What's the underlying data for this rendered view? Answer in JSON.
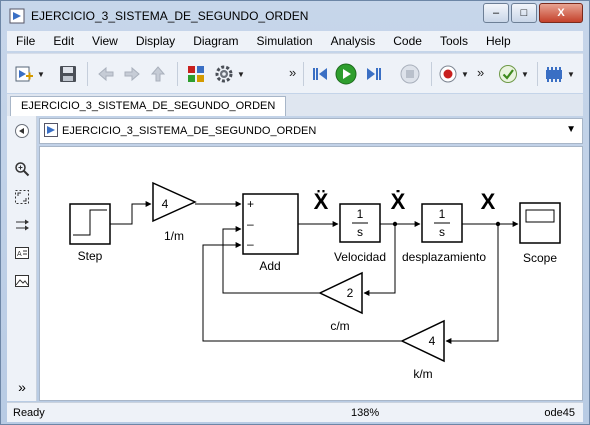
{
  "window": {
    "title": "EJERCICIO_3_SISTEMA_DE_SEGUNDO_ORDEN",
    "minimize": "–",
    "maximize": "□",
    "close": "X"
  },
  "menu": [
    "File",
    "Edit",
    "View",
    "Display",
    "Diagram",
    "Simulation",
    "Analysis",
    "Code",
    "Tools",
    "Help"
  ],
  "toolbar": {
    "overflow1": "»",
    "overflow2": "»"
  },
  "tab": {
    "label": "EJERCICIO_3_SISTEMA_DE_SEGUNDO_ORDEN"
  },
  "address": {
    "path": "EJERCICIO_3_SISTEMA_DE_SEGUNDO_ORDEN"
  },
  "diagram": {
    "step_label": "Step",
    "gain_m_value": "4",
    "gain_m_label": "1/m",
    "add_label": "Add",
    "add_signs": [
      "+",
      "–",
      "–"
    ],
    "int1_num": "1",
    "int1_den": "s",
    "int1_label": "Velocidad",
    "int2_num": "1",
    "int2_den": "s",
    "int2_label": "desplazamiento",
    "scope_label": "Scope",
    "gain_c_value": "2",
    "gain_c_label": "c/m",
    "gain_k_value": "4",
    "gain_k_label": "k/m",
    "signal_xddot": "Ẍ",
    "signal_xdot": "Ẋ",
    "signal_x": "X"
  },
  "status": {
    "left": "Ready",
    "zoom": "138%",
    "solver": "ode45"
  },
  "colors": {
    "run_green": "#2e9e2e",
    "record_red": "#c8201e",
    "close_red": "#c4412b"
  }
}
